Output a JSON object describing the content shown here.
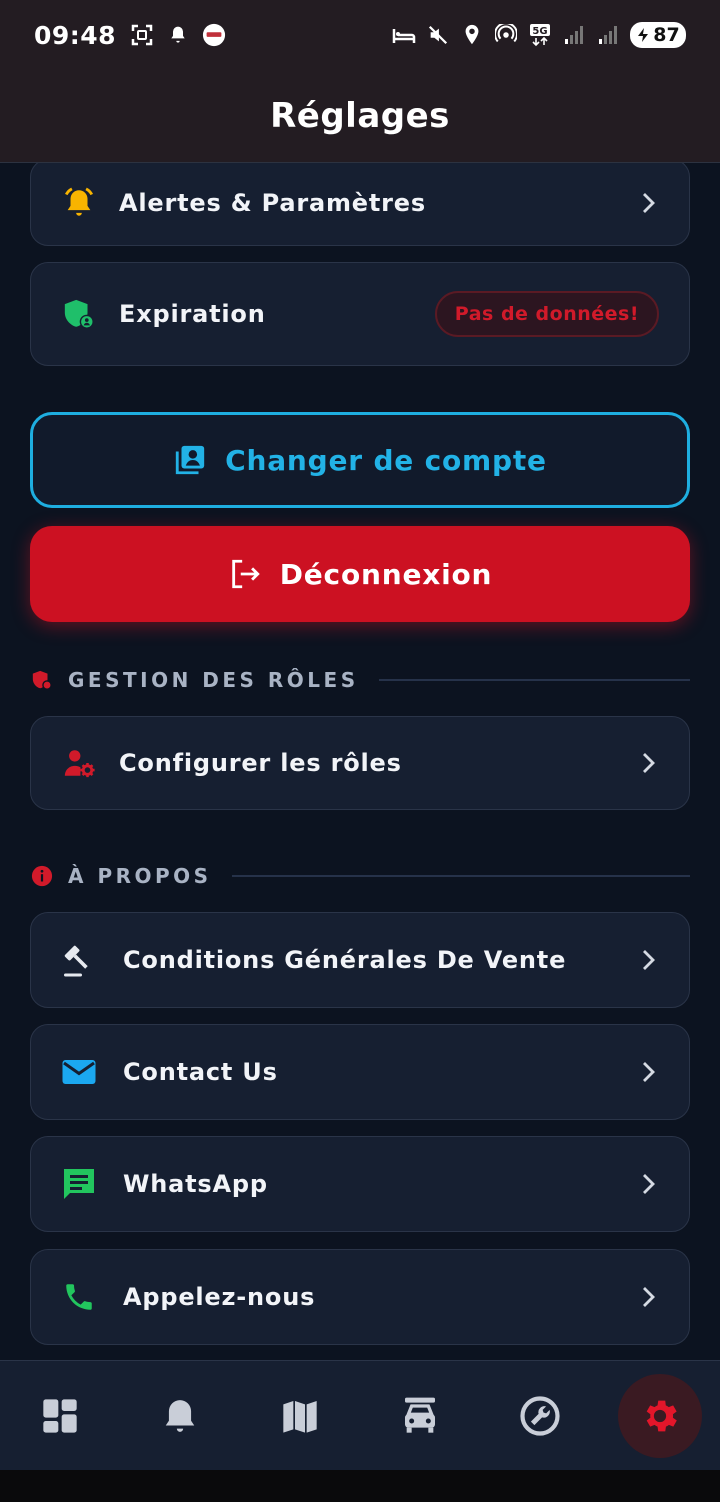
{
  "status_bar": {
    "time": "09:48",
    "battery": "87"
  },
  "header": {
    "title": "Réglages"
  },
  "items": {
    "alerts": {
      "label": "Alertes & Paramètres"
    },
    "expiration": {
      "label": "Expiration",
      "badge": "Pas de données!"
    }
  },
  "buttons": {
    "switch_account": "Changer de compte",
    "logout": "Déconnexion"
  },
  "roles_section": {
    "title": "GESTION DES RÔLES",
    "items": [
      {
        "label": "Configurer les rôles"
      }
    ]
  },
  "about_section": {
    "title": "À PROPOS",
    "items": [
      {
        "label": "Conditions Générales De Vente",
        "icon": "gavel-icon"
      },
      {
        "label": "Contact Us",
        "icon": "mail-icon"
      },
      {
        "label": "WhatsApp",
        "icon": "chat-icon"
      },
      {
        "label": "Appelez-nous",
        "icon": "phone-icon"
      }
    ]
  },
  "bottom_nav": {
    "items": [
      "dashboard-icon",
      "bell-icon",
      "map-icon",
      "car-icon",
      "wrench-icon",
      "settings-icon"
    ],
    "active": "settings-icon"
  },
  "colors": {
    "accent_blue": "#22b2e6",
    "danger_red": "#cc1122",
    "background": "#0c1320",
    "card": "#161f31"
  }
}
